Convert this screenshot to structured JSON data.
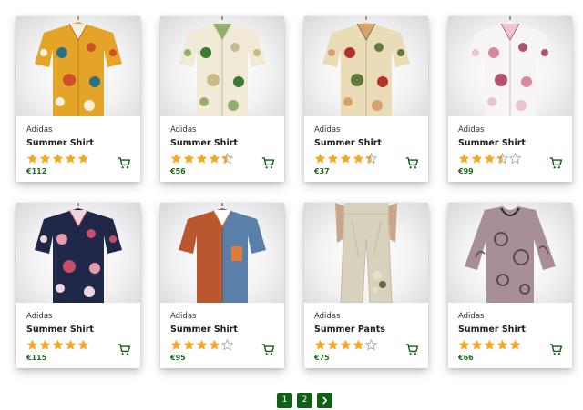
{
  "theme": {
    "accent": "#0f5f16",
    "price_color": "#1e6b1e",
    "star_color": "#f5a623",
    "star_empty": "#a8a8a8"
  },
  "products": [
    {
      "brand": "Adidas",
      "title": "Summer Shirt",
      "rating": 5,
      "price": "€112",
      "image": "shirt-orange-blue-floral",
      "colors": [
        "#e3a427",
        "#2d6f87",
        "#d14f2b",
        "#f4f0e0"
      ]
    },
    {
      "brand": "Adidas",
      "title": "Summer Shirt",
      "rating": 4.5,
      "price": "€56",
      "image": "shirt-cream-tropical-leaves",
      "colors": [
        "#f1ead6",
        "#3e7a34",
        "#c9b98a",
        "#8fb06e"
      ]
    },
    {
      "brand": "Adidas",
      "title": "Summer Shirt",
      "rating": 4.5,
      "price": "€37",
      "image": "shirt-beige-red-roses",
      "colors": [
        "#eadcb7",
        "#b2332a",
        "#5f7a3a",
        "#d8a06a"
      ]
    },
    {
      "brand": "Adidas",
      "title": "Summer Shirt",
      "rating": 3.5,
      "price": "€99",
      "image": "shirt-white-pink-blossoms",
      "colors": [
        "#f7f4f4",
        "#d88a9a",
        "#b5526b",
        "#e9c6cf"
      ]
    },
    {
      "brand": "Adidas",
      "title": "Summer Shirt",
      "rating": 5,
      "price": "€115",
      "image": "shirt-navy-pink-floral",
      "colors": [
        "#20284a",
        "#e79aac",
        "#c64f6c",
        "#f0d5dc"
      ]
    },
    {
      "brand": "Adidas",
      "title": "Summer Shirt",
      "rating": 4,
      "price": "€95",
      "image": "shirt-rust-denim-colorblock",
      "colors": [
        "#b9582f",
        "#5a7fa8",
        "#e47a3a",
        "#ffffff"
      ]
    },
    {
      "brand": "Adidas",
      "title": "Summer Pants",
      "rating": 4,
      "price": "€75",
      "image": "pants-beige-linen",
      "colors": [
        "#d8d2bd",
        "#c2bca6",
        "#6b6650",
        "#e8e2cc"
      ]
    },
    {
      "brand": "Adidas",
      "title": "Summer Shirt",
      "rating": 5,
      "price": "€66",
      "image": "blouse-mauve-paisley",
      "colors": [
        "#a88e96",
        "#5a4a4e",
        "#c9b3ba",
        "#2e2428"
      ]
    }
  ],
  "pagination": {
    "pages": [
      "1",
      "2"
    ],
    "next_icon": "chevron-right-icon"
  },
  "cart_icon": "cart-icon"
}
